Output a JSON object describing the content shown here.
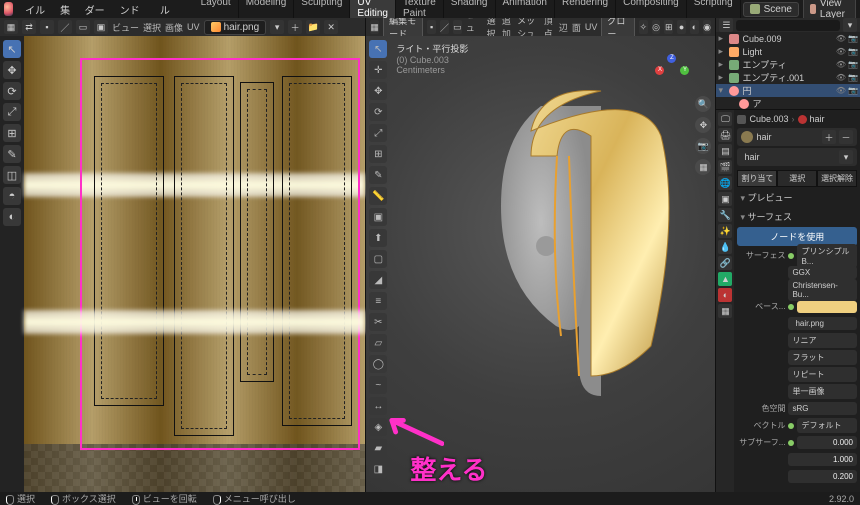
{
  "top_menu": {
    "file": "ファイル",
    "edit": "編集",
    "render": "レンダー",
    "window": "ウィンドウ",
    "help": "ヘルプ"
  },
  "workspaces": {
    "layout": "Layout",
    "modeling": "Modeling",
    "sculpting": "Sculpting",
    "uv": "UV Editing",
    "texpaint": "Texture Paint",
    "shading": "Shading",
    "animation": "Animation",
    "rendering": "Rendering",
    "compositing": "Compositing",
    "scripting": "Scripting"
  },
  "scene": {
    "label": "Scene",
    "viewlayer": "View Layer"
  },
  "uv_header": {
    "viewmenu": "ビュー",
    "select": "選択",
    "image": "画像",
    "uvmenu": "UV",
    "filename": "hair.png"
  },
  "view_header": {
    "mode": "編集モード",
    "viewmenu": "ビュー",
    "select": "選択",
    "add": "追加",
    "mesh": "メッシュ",
    "vertex": "頂点",
    "edge": "辺",
    "face": "面",
    "uv": "UV",
    "orient_label": "グロー..."
  },
  "view_overlay": {
    "line1": "ライト・平行投影",
    "line2": "(0) Cube.003",
    "line3": "Centimeters"
  },
  "gizmo": {
    "x": "X",
    "y": "Y",
    "z": "Z"
  },
  "annotation": {
    "text": "整える"
  },
  "outliner": {
    "items": [
      {
        "icon": "cube",
        "name": "Cube.009"
      },
      {
        "icon": "light",
        "name": "Light"
      },
      {
        "icon": "emp",
        "name": "エンプティ"
      },
      {
        "icon": "emp",
        "name": "エンプティ.001"
      },
      {
        "icon": "circ",
        "name": "円"
      },
      {
        "icon": "circ",
        "name": "ア"
      }
    ]
  },
  "props": {
    "breadcrumb_obj": "Cube.003",
    "breadcrumb_mat": "hair",
    "slot_name": "hair",
    "matname": "hair",
    "tabs": {
      "assign": "割り当て",
      "select": "選択",
      "deselect": "選択解除"
    },
    "preview": "プレビュー",
    "surface": "サーフェス",
    "use_nodes": "ノードを使用",
    "rows": {
      "surface_lbl": "サーフェス",
      "surface_val": "プリンシプルB...",
      "ggx": "GGX",
      "christensen": "Christensen-Bu...",
      "base_lbl": "ベース...",
      "image_file": "hair.png",
      "linear": "リニア",
      "flat": "フラット",
      "repeat": "リピート",
      "single": "単一画像",
      "colorspace_lbl": "色空間",
      "colorspace_val": "sRG",
      "vector_lbl": "ベクトル",
      "vector_val": "デフォルト",
      "subsurf_lbl": "サブサーフ...",
      "subsurf_val": "0.000",
      "num1": "1.000",
      "num2": "0.200"
    }
  },
  "status": {
    "select": "選択",
    "boxselect": "ボックス選択",
    "rotview": "ビューを回転",
    "callmenu": "メニュー呼び出し",
    "version": "2.92.0"
  }
}
